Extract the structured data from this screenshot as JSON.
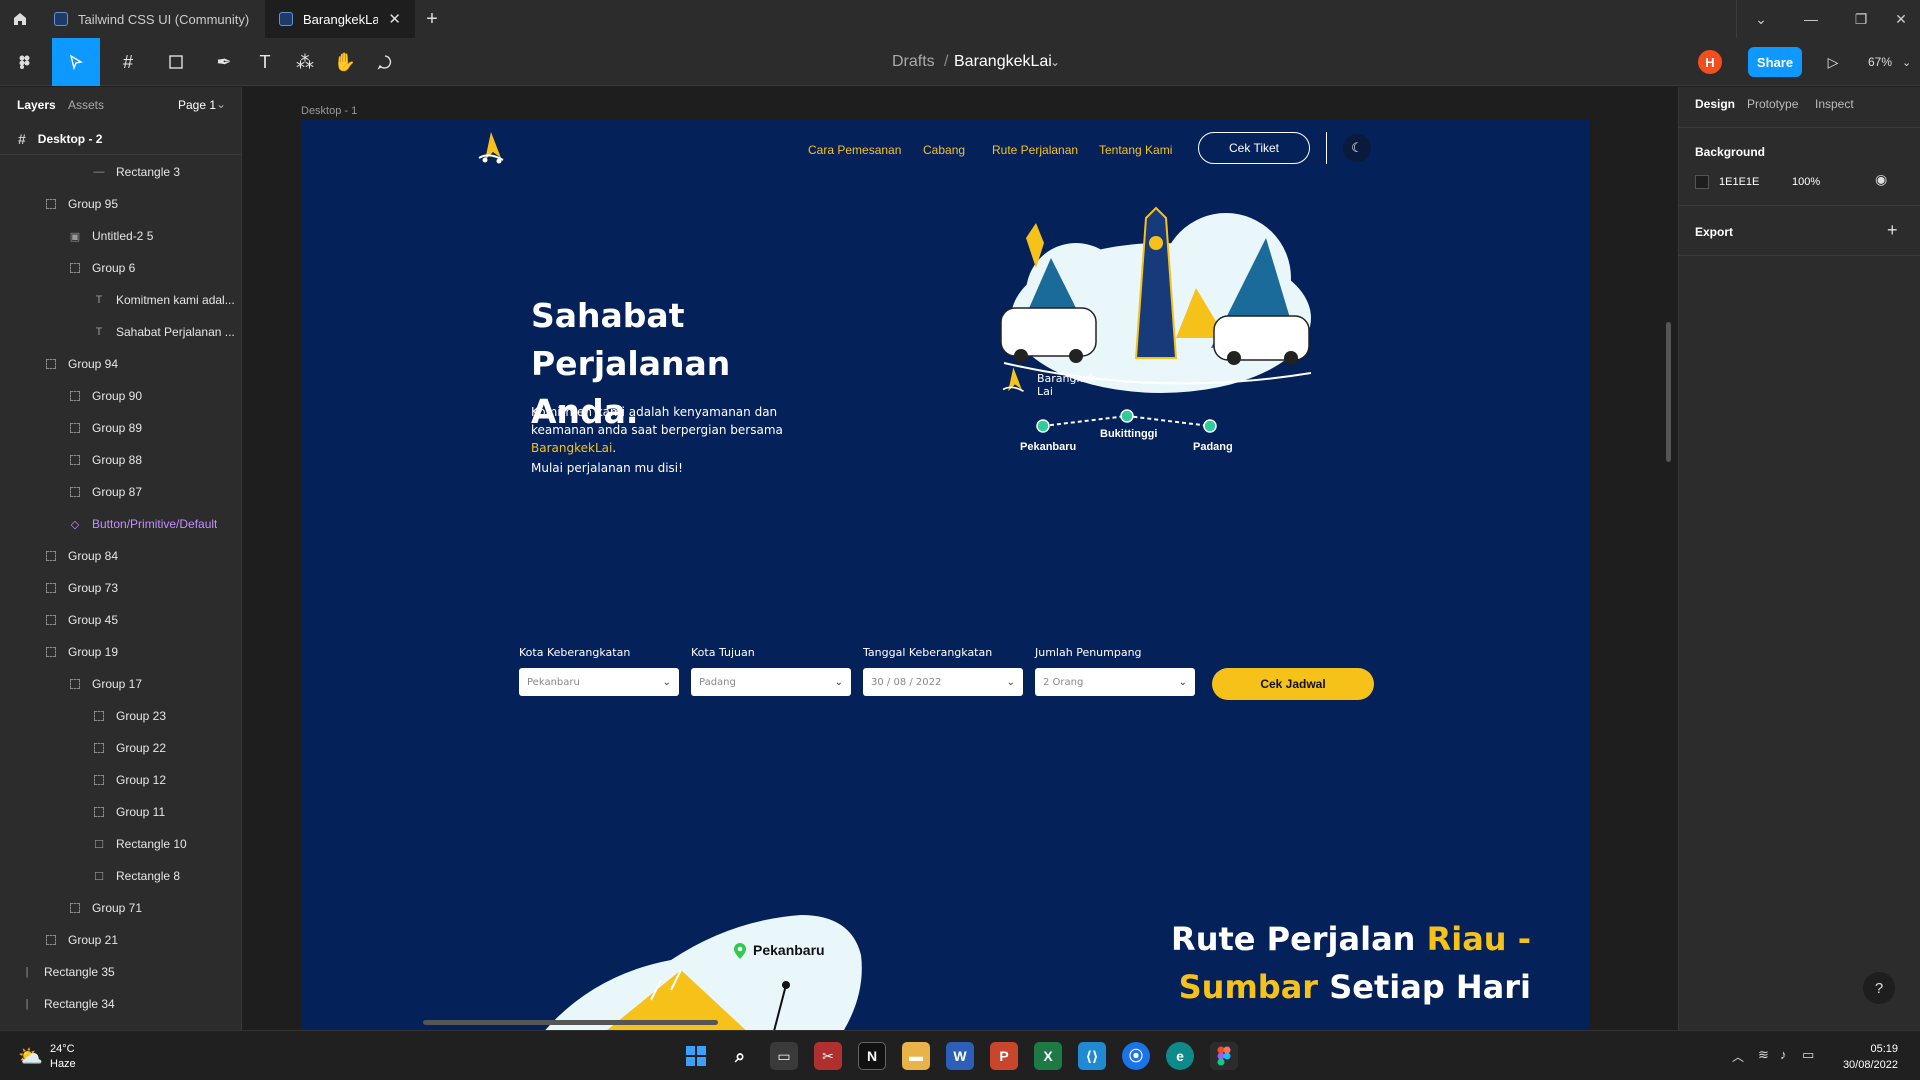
{
  "titlebar": {
    "tabs": [
      {
        "label": "Tailwind CSS UI (Community)"
      },
      {
        "label": "BarangkekLai",
        "active": true
      }
    ],
    "new_tab": "+"
  },
  "toolbar": {
    "breadcrumb_parent": "Drafts",
    "breadcrumb_sep": "/",
    "file_name": "BarangkekLai",
    "avatar_initial": "H",
    "share_label": "Share",
    "zoom": "67%"
  },
  "layers_panel": {
    "tab_layers": "Layers",
    "tab_assets": "Assets",
    "page": "Page 1",
    "frame": "Desktop - 2",
    "items": [
      {
        "label": "Rectangle 3",
        "indent": 3,
        "icon": "line-icon"
      },
      {
        "label": "Group 95",
        "indent": 1,
        "icon": "group-icon"
      },
      {
        "label": "Untitled-2 5",
        "indent": 2,
        "icon": "image-icon"
      },
      {
        "label": "Group 6",
        "indent": 2,
        "icon": "group-icon"
      },
      {
        "label": "Komitmen kami adal...",
        "indent": 3,
        "icon": "text-icon"
      },
      {
        "label": "Sahabat Perjalanan ...",
        "indent": 3,
        "icon": "text-icon"
      },
      {
        "label": "Group 94",
        "indent": 1,
        "icon": "group-icon"
      },
      {
        "label": "Group 90",
        "indent": 2,
        "icon": "group-icon"
      },
      {
        "label": "Group 89",
        "indent": 2,
        "icon": "group-icon"
      },
      {
        "label": "Group 88",
        "indent": 2,
        "icon": "group-icon"
      },
      {
        "label": "Group 87",
        "indent": 2,
        "icon": "group-icon"
      },
      {
        "label": "Button/Primitive/Default",
        "indent": 2,
        "icon": "component-icon",
        "purple": true
      },
      {
        "label": "Group 84",
        "indent": 1,
        "icon": "group-icon"
      },
      {
        "label": "Group 73",
        "indent": 1,
        "icon": "group-icon"
      },
      {
        "label": "Group 45",
        "indent": 1,
        "icon": "group-icon"
      },
      {
        "label": "Group 19",
        "indent": 1,
        "icon": "group-icon"
      },
      {
        "label": "Group 17",
        "indent": 2,
        "icon": "group-icon"
      },
      {
        "label": "Group 23",
        "indent": 3,
        "icon": "group-icon"
      },
      {
        "label": "Group 22",
        "indent": 3,
        "icon": "group-icon"
      },
      {
        "label": "Group 12",
        "indent": 3,
        "icon": "group-icon"
      },
      {
        "label": "Group 11",
        "indent": 3,
        "icon": "group-icon"
      },
      {
        "label": "Rectangle 10",
        "indent": 3,
        "icon": "rect-icon"
      },
      {
        "label": "Rectangle 8",
        "indent": 3,
        "icon": "rect-icon"
      },
      {
        "label": "Group 71",
        "indent": 2,
        "icon": "group-icon"
      },
      {
        "label": "Group 21",
        "indent": 1,
        "icon": "group-icon"
      },
      {
        "label": "Rectangle 35",
        "indent": 0,
        "icon": "bar-icon"
      },
      {
        "label": "Rectangle 34",
        "indent": 0,
        "icon": "bar-icon"
      }
    ]
  },
  "canvas": {
    "frame_label": "Desktop - 1"
  },
  "site": {
    "nav": [
      "Cara Pemesanan",
      "Cabang",
      "Rute Perjalanan",
      "Tentang Kami"
    ],
    "cek_tiket": "Cek Tiket",
    "hero_title": "Sahabat Perjalanan Anda.",
    "hero_sub_1": "Komitmen kami adalah kenyamanan dan keamanan anda saat berpergian bersama",
    "hero_brand": "BarangkekLai",
    "hero_period": ".",
    "hero_cta_text": "Mulai perjalanan mu disi!",
    "illustration_brand_1": "Barangkek",
    "illustration_brand_2": "Lai",
    "cities": [
      "Pekanbaru",
      "Bukittinggi",
      "Padang"
    ],
    "form": {
      "labels": [
        "Kota Keberangkatan",
        "Kota Tujuan",
        "Tanggal Keberangkatan",
        "Jumlah Penumpang"
      ],
      "values": [
        "Pekanbaru",
        "Padang",
        "30 / 08 / 2022",
        "2 Orang"
      ],
      "submit": "Cek Jadwal"
    },
    "route_title_1": "Rute Perjalan",
    "route_title_hl1": "Riau -",
    "route_title_hl2": "Sumbar",
    "route_title_2": "Setiap Hari",
    "map_pin_label": "Pekanbaru"
  },
  "design_panel": {
    "tabs": [
      "Design",
      "Prototype",
      "Inspect"
    ],
    "background_label": "Background",
    "background_hex": "1E1E1E",
    "background_opacity": "100%",
    "export_label": "Export",
    "help": "?"
  },
  "taskbar": {
    "weather_temp": "24°C",
    "weather_desc": "Haze",
    "time": "05:19",
    "date": "30/08/2022"
  },
  "colors": {
    "accent_blue": "#0d99ff",
    "site_bg": "#04215a",
    "site_yellow": "#f6c21a",
    "component_purple": "#c48fff"
  }
}
